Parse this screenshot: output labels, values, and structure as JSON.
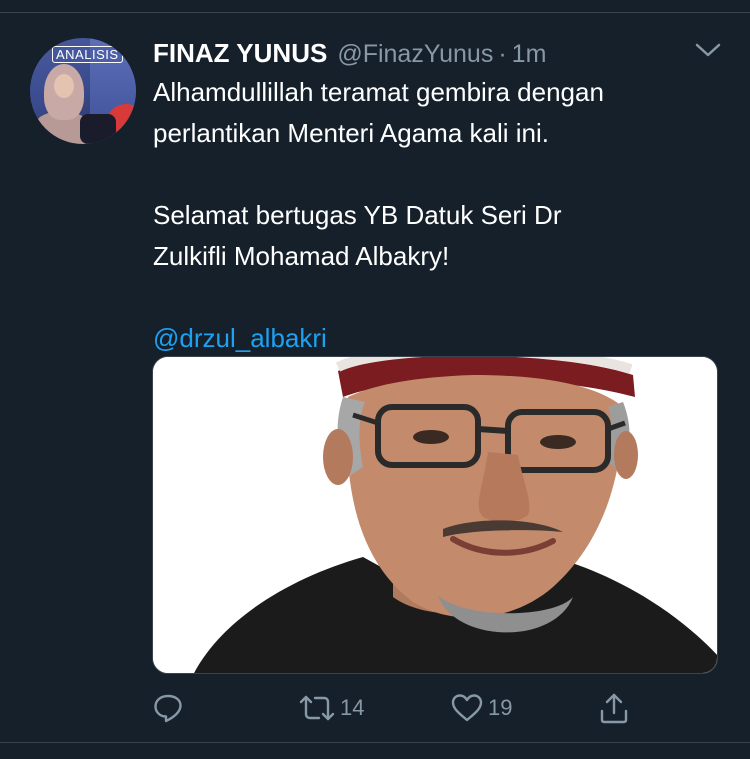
{
  "tweet": {
    "author_name": "FINAZ YUNUS",
    "author_handle": "@FinazYunus",
    "separator": "·",
    "time": "1m",
    "avatar_sign": "ANALISIS",
    "text_lines": [
      "Alhamdullillah teramat gembira dengan",
      "perlantikan Menteri Agama kali ini.",
      "",
      "Selamat bertugas YB Datuk Seri Dr",
      "Zulkifli Mohamad Albakry!",
      "",
      "@drzul_albakri"
    ],
    "mention": "@drzul_albakri"
  },
  "actions": {
    "reply": {
      "icon": "reply-icon",
      "count": ""
    },
    "retweet": {
      "icon": "retweet-icon",
      "count": "14"
    },
    "like": {
      "icon": "heart-icon",
      "count": "19"
    },
    "share": {
      "icon": "share-icon",
      "count": ""
    }
  },
  "colors": {
    "background": "#15202b",
    "text": "#ffffff",
    "secondary": "#8899a6",
    "link": "#1da1f2",
    "divider": "#38444d"
  }
}
